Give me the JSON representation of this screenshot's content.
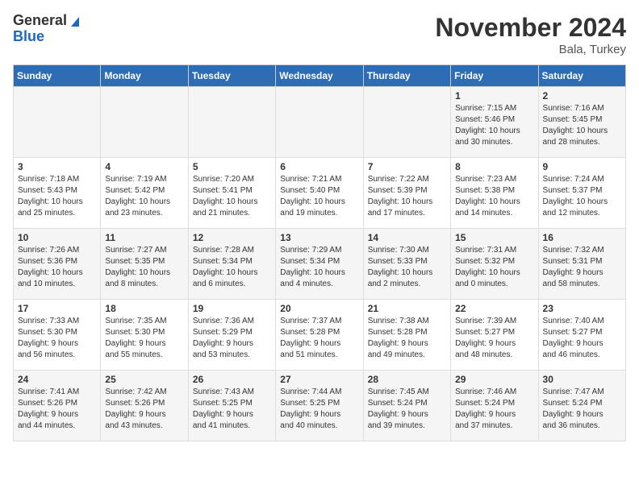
{
  "header": {
    "logo_general": "General",
    "logo_blue": "Blue",
    "month": "November 2024",
    "location": "Bala, Turkey"
  },
  "days_of_week": [
    "Sunday",
    "Monday",
    "Tuesday",
    "Wednesday",
    "Thursday",
    "Friday",
    "Saturday"
  ],
  "weeks": [
    [
      {
        "day": "",
        "info": ""
      },
      {
        "day": "",
        "info": ""
      },
      {
        "day": "",
        "info": ""
      },
      {
        "day": "",
        "info": ""
      },
      {
        "day": "",
        "info": ""
      },
      {
        "day": "1",
        "info": "Sunrise: 7:15 AM\nSunset: 5:46 PM\nDaylight: 10 hours\nand 30 minutes."
      },
      {
        "day": "2",
        "info": "Sunrise: 7:16 AM\nSunset: 5:45 PM\nDaylight: 10 hours\nand 28 minutes."
      }
    ],
    [
      {
        "day": "3",
        "info": "Sunrise: 7:18 AM\nSunset: 5:43 PM\nDaylight: 10 hours\nand 25 minutes."
      },
      {
        "day": "4",
        "info": "Sunrise: 7:19 AM\nSunset: 5:42 PM\nDaylight: 10 hours\nand 23 minutes."
      },
      {
        "day": "5",
        "info": "Sunrise: 7:20 AM\nSunset: 5:41 PM\nDaylight: 10 hours\nand 21 minutes."
      },
      {
        "day": "6",
        "info": "Sunrise: 7:21 AM\nSunset: 5:40 PM\nDaylight: 10 hours\nand 19 minutes."
      },
      {
        "day": "7",
        "info": "Sunrise: 7:22 AM\nSunset: 5:39 PM\nDaylight: 10 hours\nand 17 minutes."
      },
      {
        "day": "8",
        "info": "Sunrise: 7:23 AM\nSunset: 5:38 PM\nDaylight: 10 hours\nand 14 minutes."
      },
      {
        "day": "9",
        "info": "Sunrise: 7:24 AM\nSunset: 5:37 PM\nDaylight: 10 hours\nand 12 minutes."
      }
    ],
    [
      {
        "day": "10",
        "info": "Sunrise: 7:26 AM\nSunset: 5:36 PM\nDaylight: 10 hours\nand 10 minutes."
      },
      {
        "day": "11",
        "info": "Sunrise: 7:27 AM\nSunset: 5:35 PM\nDaylight: 10 hours\nand 8 minutes."
      },
      {
        "day": "12",
        "info": "Sunrise: 7:28 AM\nSunset: 5:34 PM\nDaylight: 10 hours\nand 6 minutes."
      },
      {
        "day": "13",
        "info": "Sunrise: 7:29 AM\nSunset: 5:34 PM\nDaylight: 10 hours\nand 4 minutes."
      },
      {
        "day": "14",
        "info": "Sunrise: 7:30 AM\nSunset: 5:33 PM\nDaylight: 10 hours\nand 2 minutes."
      },
      {
        "day": "15",
        "info": "Sunrise: 7:31 AM\nSunset: 5:32 PM\nDaylight: 10 hours\nand 0 minutes."
      },
      {
        "day": "16",
        "info": "Sunrise: 7:32 AM\nSunset: 5:31 PM\nDaylight: 9 hours\nand 58 minutes."
      }
    ],
    [
      {
        "day": "17",
        "info": "Sunrise: 7:33 AM\nSunset: 5:30 PM\nDaylight: 9 hours\nand 56 minutes."
      },
      {
        "day": "18",
        "info": "Sunrise: 7:35 AM\nSunset: 5:30 PM\nDaylight: 9 hours\nand 55 minutes."
      },
      {
        "day": "19",
        "info": "Sunrise: 7:36 AM\nSunset: 5:29 PM\nDaylight: 9 hours\nand 53 minutes."
      },
      {
        "day": "20",
        "info": "Sunrise: 7:37 AM\nSunset: 5:28 PM\nDaylight: 9 hours\nand 51 minutes."
      },
      {
        "day": "21",
        "info": "Sunrise: 7:38 AM\nSunset: 5:28 PM\nDaylight: 9 hours\nand 49 minutes."
      },
      {
        "day": "22",
        "info": "Sunrise: 7:39 AM\nSunset: 5:27 PM\nDaylight: 9 hours\nand 48 minutes."
      },
      {
        "day": "23",
        "info": "Sunrise: 7:40 AM\nSunset: 5:27 PM\nDaylight: 9 hours\nand 46 minutes."
      }
    ],
    [
      {
        "day": "24",
        "info": "Sunrise: 7:41 AM\nSunset: 5:26 PM\nDaylight: 9 hours\nand 44 minutes."
      },
      {
        "day": "25",
        "info": "Sunrise: 7:42 AM\nSunset: 5:26 PM\nDaylight: 9 hours\nand 43 minutes."
      },
      {
        "day": "26",
        "info": "Sunrise: 7:43 AM\nSunset: 5:25 PM\nDaylight: 9 hours\nand 41 minutes."
      },
      {
        "day": "27",
        "info": "Sunrise: 7:44 AM\nSunset: 5:25 PM\nDaylight: 9 hours\nand 40 minutes."
      },
      {
        "day": "28",
        "info": "Sunrise: 7:45 AM\nSunset: 5:24 PM\nDaylight: 9 hours\nand 39 minutes."
      },
      {
        "day": "29",
        "info": "Sunrise: 7:46 AM\nSunset: 5:24 PM\nDaylight: 9 hours\nand 37 minutes."
      },
      {
        "day": "30",
        "info": "Sunrise: 7:47 AM\nSunset: 5:24 PM\nDaylight: 9 hours\nand 36 minutes."
      }
    ]
  ]
}
